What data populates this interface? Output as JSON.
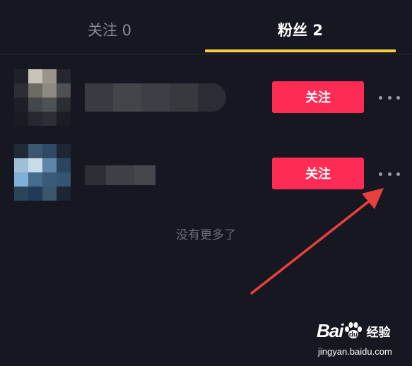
{
  "tabs": {
    "following_label": "关注 0",
    "fans_label": "粉丝 2",
    "active": "fans"
  },
  "fans_list": [
    {
      "follow_button_label": "关注",
      "more_icon": "more-horizontal-icon",
      "avatar_pixelated": true,
      "name_pixelated": true
    },
    {
      "follow_button_label": "关注",
      "more_icon": "more-horizontal-icon",
      "avatar_pixelated": true,
      "name_pixelated": true
    }
  ],
  "end_text": "没有更多了",
  "watermark": {
    "bai": "Bai",
    "du": "du",
    "jingyan": "经验",
    "url": "jingyan.baidu.com"
  },
  "colors": {
    "background": "#171722",
    "follow_button": "#fe2c55",
    "tab_underline": "#f5d041",
    "arrow": "#e8413b",
    "inactive_tab_text": "#8a8a93",
    "end_text": "#6d6d78"
  }
}
